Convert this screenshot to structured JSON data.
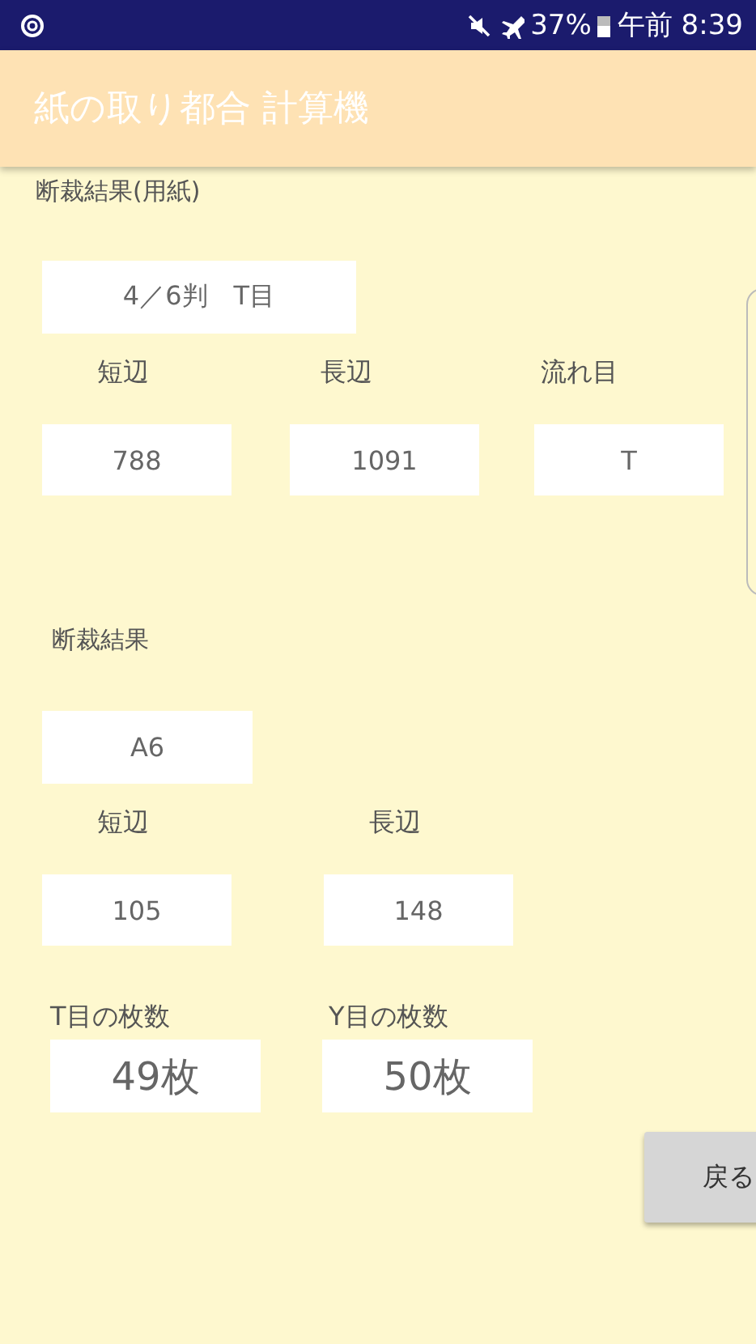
{
  "status_bar": {
    "battery": "37%",
    "time": "午前 8:39"
  },
  "app_bar": {
    "title": "紙の取り都合 計算機"
  },
  "paper": {
    "heading": "断裁結果(用紙)",
    "size": "4／6判　T目",
    "fields": [
      {
        "label": "短辺",
        "value": "788"
      },
      {
        "label": "長辺",
        "value": "1091"
      },
      {
        "label": "流れ目",
        "value": "T"
      }
    ]
  },
  "cut": {
    "heading": "断裁結果",
    "size": "A6",
    "fields": [
      {
        "label": "短辺",
        "value": "105"
      },
      {
        "label": "長辺",
        "value": "148"
      }
    ]
  },
  "counts": [
    {
      "label": "T目の枚数",
      "value": "49枚"
    },
    {
      "label": "Y目の枚数",
      "value": "50枚"
    }
  ],
  "back_button": "戻る"
}
